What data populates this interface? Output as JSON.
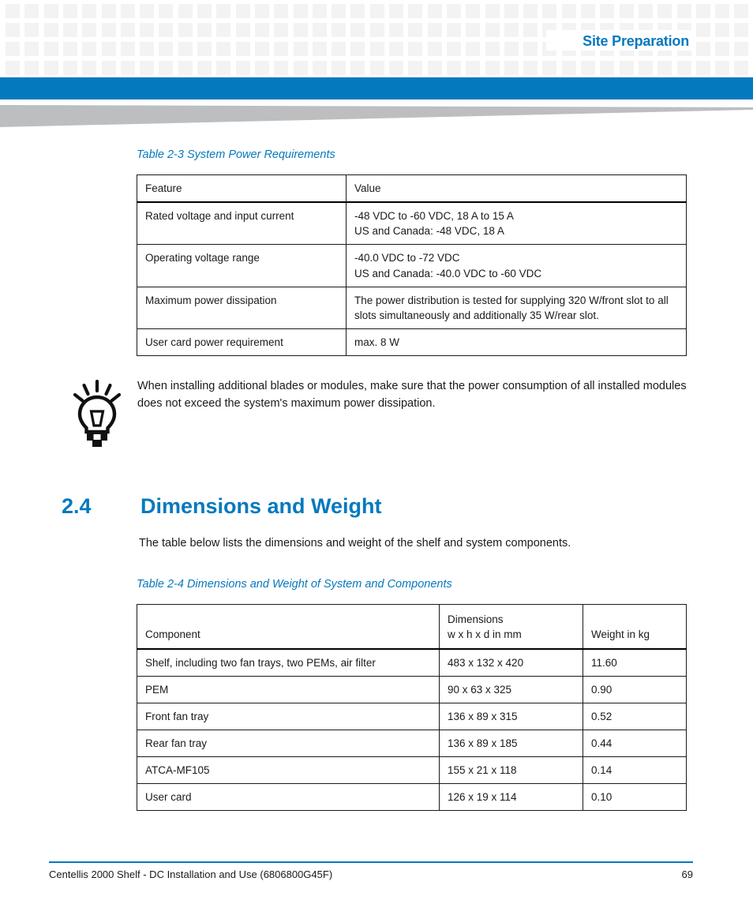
{
  "header": {
    "title": "Site Preparation",
    "accent_color": "#0579be",
    "band_color": "#bcbec0",
    "pattern_square_color": "#f3f3f4"
  },
  "table_power": {
    "caption": "Table 2-3 System Power Requirements",
    "columns": [
      "Feature",
      "Value"
    ],
    "rows": [
      {
        "feature": "Rated voltage and input current",
        "value_lines": [
          "-48 VDC to -60 VDC, 18 A to 15 A",
          "US and Canada: -48 VDC, 18 A"
        ]
      },
      {
        "feature": "Operating voltage range",
        "value_lines": [
          "-40.0 VDC to -72 VDC",
          "US and Canada: -40.0 VDC to -60 VDC"
        ]
      },
      {
        "feature": "Maximum power dissipation",
        "value_lines": [
          "The power distribution is tested for supplying 320 W/front slot to all slots simultaneously and additionally 35 W/rear slot."
        ]
      },
      {
        "feature": "User card power requirement",
        "value_lines": [
          "max. 8 W"
        ]
      }
    ]
  },
  "tip": {
    "icon": "lightbulb-icon",
    "text": "When installing additional blades or modules, make sure that the power consumption of all installed modules does not exceed the system's maximum power dissipation."
  },
  "section": {
    "number": "2.4",
    "title": "Dimensions and Weight",
    "intro": "The table below lists the dimensions and weight of the shelf and system components."
  },
  "table_dims": {
    "caption": "Table 2-4 Dimensions and Weight of System and Components",
    "columns": {
      "component": "Component",
      "dimensions_line1": "Dimensions",
      "dimensions_line2": "w x h x d in mm",
      "weight": "Weight in kg"
    },
    "rows": [
      {
        "component": "Shelf, including two fan trays, two PEMs, air filter",
        "dimensions": "483 x 132 x 420",
        "weight": "11.60"
      },
      {
        "component": "PEM",
        "dimensions": "90 x 63 x 325",
        "weight": "0.90"
      },
      {
        "component": "Front fan tray",
        "dimensions": "136 x 89 x 315",
        "weight": "0.52"
      },
      {
        "component": "Rear fan tray",
        "dimensions": "136 x 89 x 185",
        "weight": "0.44"
      },
      {
        "component": "ATCA-MF105",
        "dimensions": "155 x 21 x 118",
        "weight": "0.14"
      },
      {
        "component": "User card",
        "dimensions": "126 x 19 x 114",
        "weight": "0.10"
      }
    ]
  },
  "footer": {
    "document_title": "Centellis 2000 Shelf - DC Installation and Use (6806800G45F)",
    "page_number": "69"
  }
}
